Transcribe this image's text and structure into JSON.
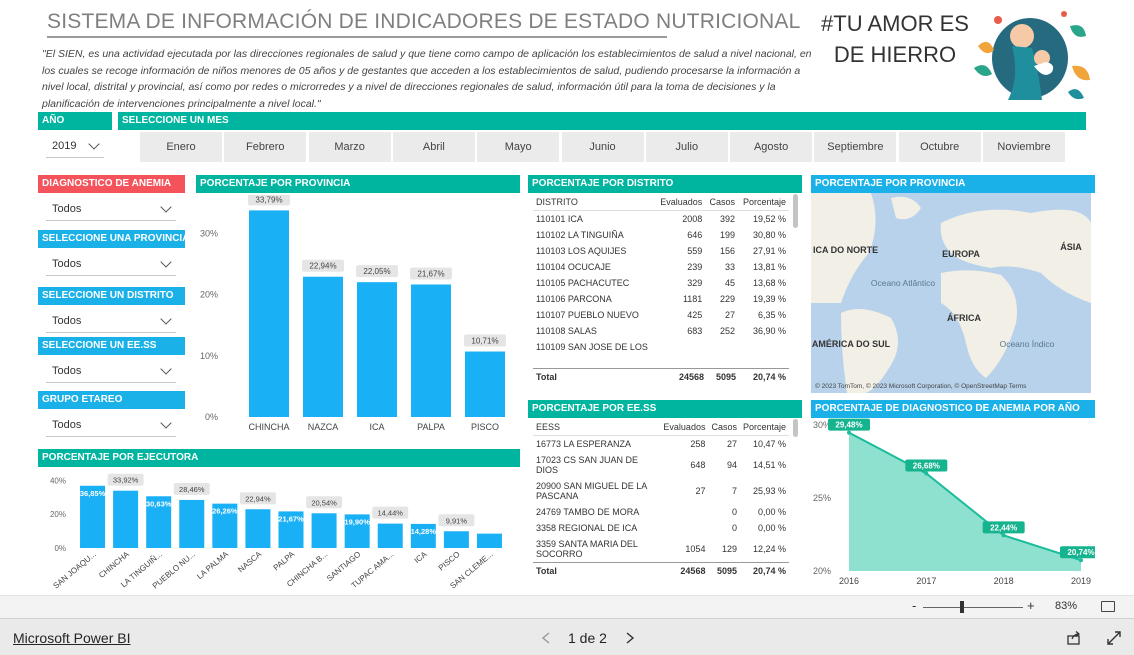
{
  "header": {
    "title": "SISTEMA DE INFORMACIÓN DE INDICADORES DE ESTADO NUTRICIONAL",
    "description": "\"El SIEN, es una actividad ejecutada por las direcciones regionales de salud y que tiene como campo de aplicación los establecimientos de salud a nivel nacional, en los cuales se recoge información de niños menores de 05 años y de gestantes que acceden a los establecimientos de salud, pudiendo procesarse la información a nivel local, distrital y provincial, así como por redes o microrredes y a nivel de direcciones regionales de salud, información útil para la toma de decisiones y la planificación de intervenciones principalmente a nivel local.\"",
    "slogan_line1": "#TU AMOR ES",
    "slogan_line2": "DE HIERRO"
  },
  "filters": {
    "year_label": "AÑO",
    "year_value": "2019",
    "month_label": "SELECCIONE UN MES",
    "months": [
      "Enero",
      "Febrero",
      "Marzo",
      "Abril",
      "Mayo",
      "Junio",
      "Julio",
      "Agosto",
      "Septiembre",
      "Octubre",
      "Noviembre"
    ],
    "diagnostico_label": "DIAGNOSTICO DE ANEMIA",
    "diagnostico_value": "Todos",
    "provincia_label": "SELECCIONE UNA PROVINCIA",
    "provincia_value": "Todos",
    "distrito_label": "SELECCIONE UN DISTRITO",
    "distrito_value": "Todos",
    "eess_label": "SELECCIONE UN EE.SS",
    "eess_value": "Todos",
    "grupo_label": "GRUPO ETAREO",
    "grupo_value": "Todos"
  },
  "panels": {
    "provincia_title": "PORCENTAJE POR PROVINCIA",
    "ejecutora_title": "PORCENTAJE POR EJECUTORA",
    "distrito_title": "PORCENTAJE POR DISTRITO",
    "eess_title": "PORCENTAJE POR EE.SS",
    "map_title": "PORCENTAJE POR PROVINCIA",
    "anio_title": "PORCENTAJE DE DIAGNOSTICO DE ANEMIA POR AÑO"
  },
  "distrito_table": {
    "columns": [
      "DISTRITO",
      "Evaluados",
      "Casos",
      "Porcentaje"
    ],
    "rows": [
      [
        "110101 ICA",
        "2008",
        "392",
        "19,52 %"
      ],
      [
        "110102 LA TINGUIÑA",
        "646",
        "199",
        "30,80 %"
      ],
      [
        "110103 LOS AQUIJES",
        "559",
        "156",
        "27,91 %"
      ],
      [
        "110104 OCUCAJE",
        "239",
        "33",
        "13,81 %"
      ],
      [
        "110105 PACHACUTEC",
        "329",
        "45",
        "13,68 %"
      ],
      [
        "110106 PARCONA",
        "1181",
        "229",
        "19,39 %"
      ],
      [
        "110107 PUEBLO NUEVO",
        "425",
        "27",
        "6,35 %"
      ],
      [
        "110108 SALAS",
        "683",
        "252",
        "36,90 %"
      ]
    ],
    "partial_row": "110109 SAN JOSE DE LOS",
    "total": [
      "Total",
      "24568",
      "5095",
      "20,74 %"
    ]
  },
  "eess_table": {
    "columns": [
      "EESS",
      "Evaluados",
      "Casos",
      "Porcentaje"
    ],
    "rows": [
      [
        "16773 LA ESPERANZA",
        "258",
        "27",
        "10,47 %"
      ],
      [
        "17023 CS SAN JUAN DE DIOS",
        "648",
        "94",
        "14,51 %"
      ],
      [
        "20900 SAN MIGUEL DE LA PASCANA",
        "27",
        "7",
        "25,93 %"
      ],
      [
        "24769 TAMBO DE MORA",
        "",
        "0",
        "0,00 %"
      ],
      [
        "3358 REGIONAL DE ICA",
        "",
        "0",
        "0,00 %"
      ],
      [
        "3359 SANTA MARIA DEL SOCORRO",
        "1054",
        "129",
        "12,24 %"
      ]
    ],
    "total": [
      "Total",
      "24568",
      "5095",
      "20,74 %"
    ]
  },
  "map": {
    "labels": [
      "ICA DO NORTE",
      "EUROPA",
      "ÁSIA",
      "Oceano Atlântico",
      "ÁFRICA",
      "AMÉRICA DO SUL",
      "Oceano Índico"
    ],
    "attribution": "© 2023 TomTom, © 2023 Microsoft Corporation, © OpenStreetMap  Terms",
    "land_color": "#f2efe6",
    "water_color": "#b7d2ea"
  },
  "chart_data": [
    {
      "type": "bar",
      "title": "PORCENTAJE POR PROVINCIA",
      "categories": [
        "CHINCHA",
        "NAZCA",
        "ICA",
        "PALPA",
        "PISCO"
      ],
      "values": [
        33.79,
        22.94,
        22.05,
        21.67,
        10.71
      ],
      "value_labels": [
        "33,79%",
        "22,94%",
        "22,05%",
        "21,67%",
        "10,71%"
      ],
      "ylim": [
        0,
        35
      ],
      "yticks": [
        "0%",
        "10%",
        "20%",
        "30%"
      ],
      "color": "#1ab0f5"
    },
    {
      "type": "bar",
      "title": "PORCENTAJE POR EJECUTORA",
      "categories": [
        "SAN JOAQU...",
        "CHINCHA",
        "LA TINGUIÑ...",
        "PUEBLO NU...",
        "LA PALMA",
        "NASCA",
        "PALPA",
        "CHINCHA B...",
        "SANTIAGO",
        "TUPAC AMA...",
        "ICA",
        "PISCO",
        "SAN CLEME..."
      ],
      "values": [
        36.85,
        33.92,
        30.63,
        28.46,
        26.26,
        22.94,
        21.67,
        20.54,
        19.9,
        14.44,
        14.28,
        9.91,
        8.5
      ],
      "value_labels": [
        "36,85%",
        "33,92%",
        "30,63%",
        "28,46%",
        "26,26%",
        "22,94%",
        "21,67%",
        "20,54%",
        "19,90%",
        "14,44%",
        "14,28%",
        "9,91%",
        ""
      ],
      "ylim": [
        0,
        45
      ],
      "yticks": [
        "0%",
        "20%",
        "40%"
      ],
      "color": "#1ab0f5"
    },
    {
      "type": "area",
      "title": "PORCENTAJE DE DIAGNOSTICO DE ANEMIA POR AÑO",
      "x": [
        "2016",
        "2017",
        "2018",
        "2019"
      ],
      "values": [
        29.48,
        26.68,
        22.44,
        20.74
      ],
      "value_labels": [
        "29,48%",
        "26,68%",
        "22,44%",
        "20,74%"
      ],
      "ylim": [
        20,
        30
      ],
      "yticks": [
        "20%",
        "25%",
        "30%"
      ],
      "color": "#1abc9c"
    }
  ],
  "footer": {
    "zoom_minus": "-",
    "zoom_plus": "+",
    "zoom_value": "83%",
    "brand": "Microsoft Power BI",
    "page_indicator": "1 de 2"
  }
}
